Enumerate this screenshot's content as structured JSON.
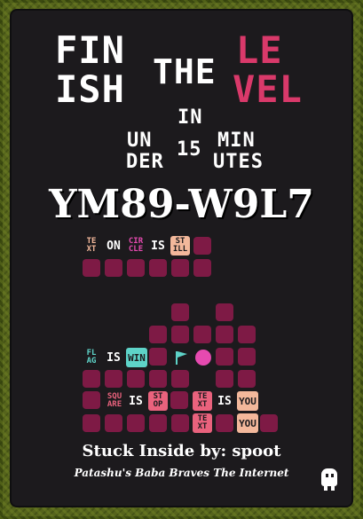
{
  "title": {
    "fin": "FIN",
    "ish": "ISH",
    "the": "THE",
    "le": "LE",
    "vel": "VEL",
    "in": "IN",
    "un": "UN",
    "der": "DER",
    "num": "15",
    "min": "MIN",
    "utes": "UTES"
  },
  "level_code": "YM89-W9L7",
  "rules": {
    "r1": {
      "noun_top": "TE",
      "noun_bot": "XT",
      "on": "ON",
      "circle_top": "CIR",
      "circle_bot": "CLE",
      "is": "IS",
      "prop_top": "ST",
      "prop_bot": "ILL"
    },
    "r2": {
      "flag_top": "FL",
      "flag_bot": "AG",
      "is": "IS",
      "win": "WIN"
    },
    "r3": {
      "square_top": "SQU",
      "square_bot": "ARE",
      "is1": "IS",
      "stop_top": "ST",
      "stop_bot": "OP",
      "text_top": "TE",
      "text_bot": "XT",
      "is2": "IS",
      "you": "YOU"
    },
    "r4": {
      "text_top": "TE",
      "text_bot": "XT",
      "you": "YOU"
    }
  },
  "credit": "Stuck Inside by: spoot",
  "subtitle": "Patashu's Baba Braves The Internet",
  "colors": {
    "background_frame": "#56641c",
    "panel": "#1c1a1d",
    "pink": "#d9396a",
    "tile": "#7e1a45",
    "win": "#5ed3c8",
    "you": "#f3b89b",
    "stop": "#e9627d",
    "still": "#f3b89b",
    "flag": "#5ed3c8",
    "circle_obj": "#e64ab0"
  }
}
